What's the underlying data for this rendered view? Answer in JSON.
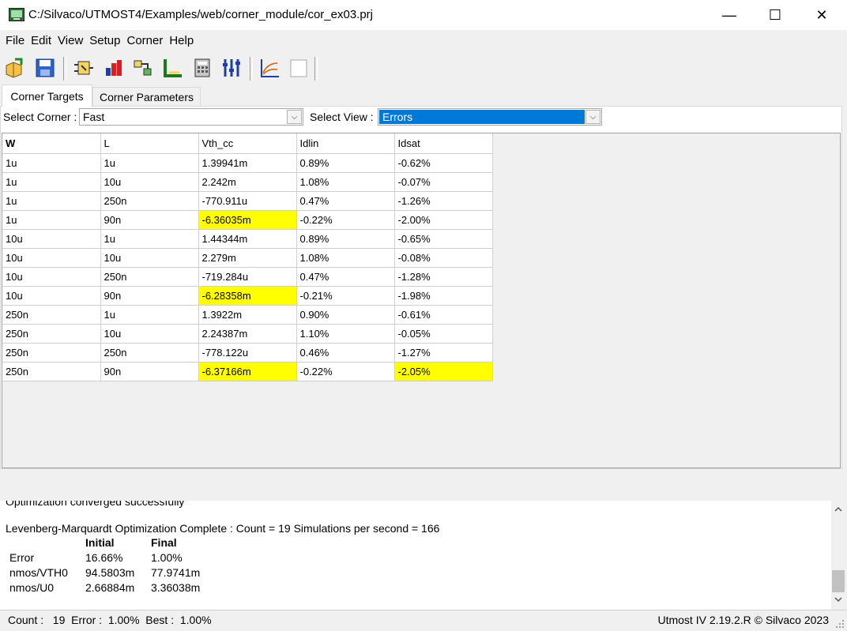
{
  "window": {
    "title": "C:/Silvaco/UTMOST4/Examples/web/corner_module/cor_ex03.prj",
    "minimize": "—",
    "maximize": "☐",
    "close": "✕"
  },
  "menu": [
    "File",
    "Edit",
    "View",
    "Setup",
    "Corner",
    "Help"
  ],
  "tabs": [
    "Corner Targets",
    "Corner Parameters"
  ],
  "controls": {
    "corner_label": "Select Corner :",
    "corner_value": "Fast",
    "view_label": "Select View :",
    "view_value": "Errors"
  },
  "grid": {
    "columns": [
      "W",
      "L",
      "Vth_cc",
      "Idlin",
      "Idsat"
    ],
    "rows": [
      [
        "1u",
        "1u",
        "1.39941m",
        "0.89%",
        "-0.62%"
      ],
      [
        "1u",
        "10u",
        "2.242m",
        "1.08%",
        "-0.07%"
      ],
      [
        "1u",
        "250n",
        "-770.911u",
        "0.47%",
        "-1.26%"
      ],
      [
        "1u",
        "90n",
        "-6.36035m",
        "-0.22%",
        "-2.00%"
      ],
      [
        "10u",
        "1u",
        "1.44344m",
        "0.89%",
        "-0.65%"
      ],
      [
        "10u",
        "10u",
        "2.279m",
        "1.08%",
        "-0.08%"
      ],
      [
        "10u",
        "250n",
        "-719.284u",
        "0.47%",
        "-1.28%"
      ],
      [
        "10u",
        "90n",
        "-6.28358m",
        "-0.21%",
        "-1.98%"
      ],
      [
        "250n",
        "1u",
        "1.3922m",
        "0.90%",
        "-0.61%"
      ],
      [
        "250n",
        "10u",
        "2.24387m",
        "1.10%",
        "-0.05%"
      ],
      [
        "250n",
        "250n",
        "-778.122u",
        "0.46%",
        "-1.27%"
      ],
      [
        "250n",
        "90n",
        "-6.37166m",
        "-0.22%",
        "-2.05%"
      ]
    ],
    "highlight_color": "#ffff00"
  },
  "log": {
    "partial_line": "Optimization converged successfully",
    "complete_line": "Levenberg-Marquardt Optimization Complete : Count = 19  Simulations per second = 166",
    "table_headers": [
      "Initial",
      "Final"
    ],
    "table_rows": [
      [
        "Error",
        "16.66%",
        "1.00%"
      ],
      [
        "nmos/VTH0",
        "94.5803m",
        "77.9741m"
      ],
      [
        "nmos/U0",
        "2.66884m",
        "3.36038m"
      ]
    ]
  },
  "status": {
    "left": "Count :   19  Error :  1.00%  Best :  1.00%",
    "right": "Utmost IV 2.19.2.R © Silvaco 2023"
  },
  "colors": {
    "selection_blue": "#0078d7",
    "highlight_yellow": "#ffff00"
  }
}
